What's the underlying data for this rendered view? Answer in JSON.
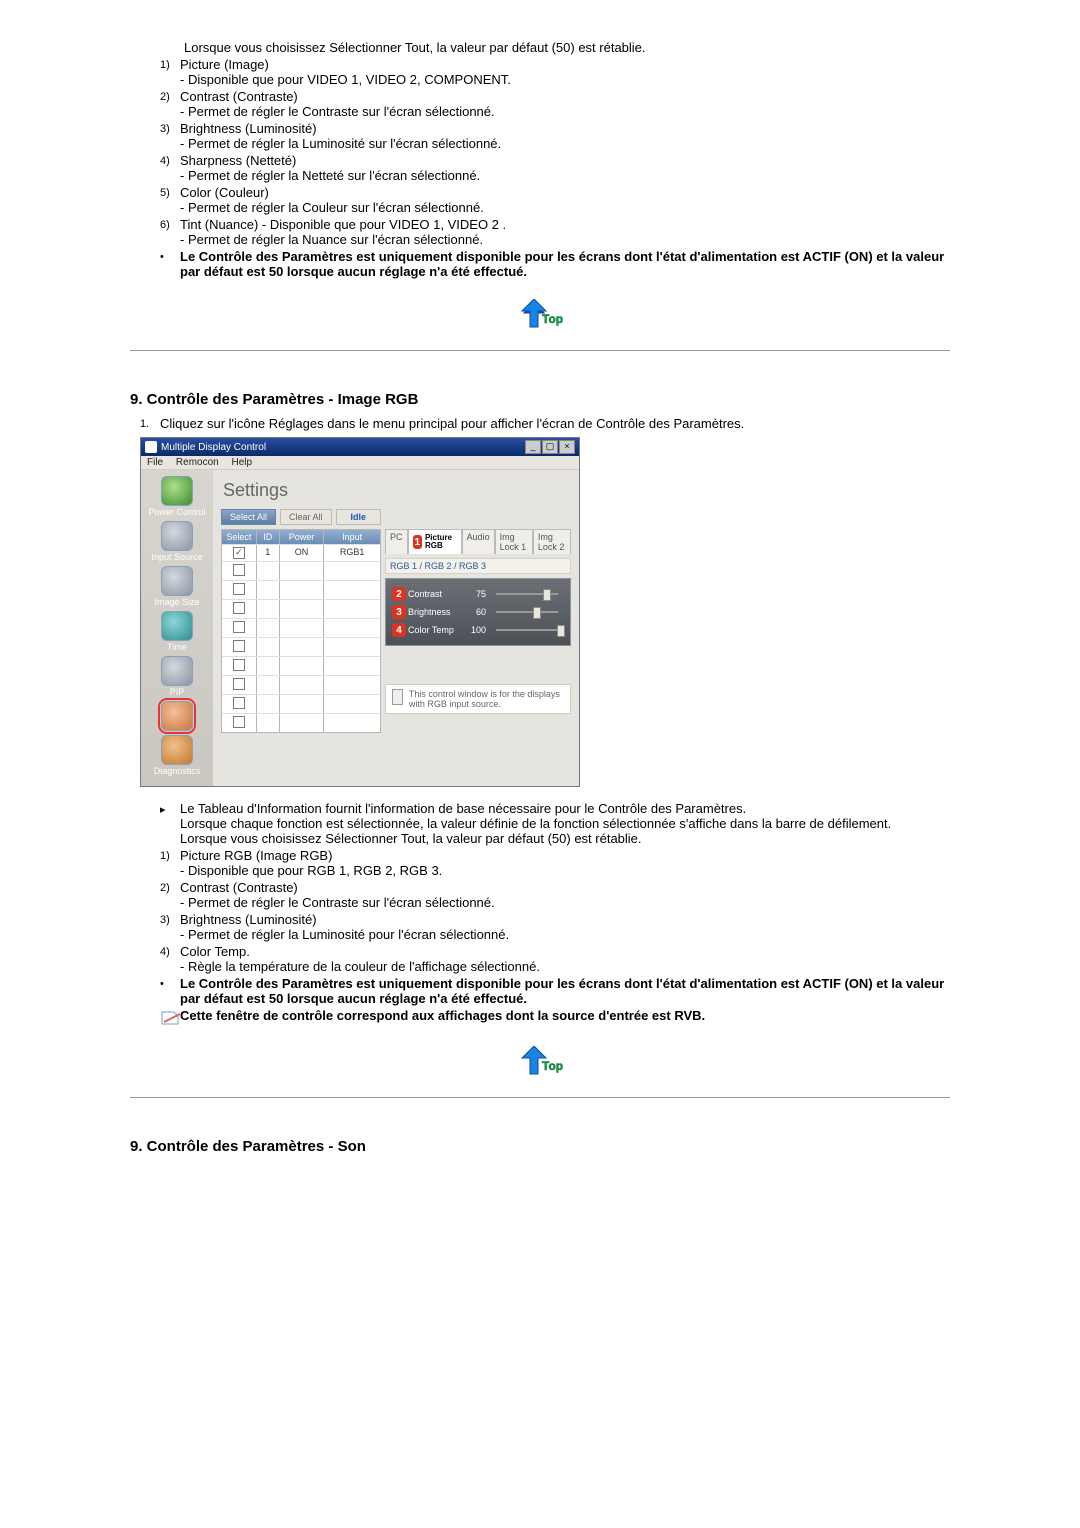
{
  "top_text": {
    "intro_default": "Lorsque vous choisissez Sélectionner Tout, la valeur par défaut (50) est rétablie.",
    "items": [
      {
        "num": "1)",
        "title": "Picture (Image)",
        "sub": "- Disponible que pour VIDEO 1, VIDEO 2, COMPONENT."
      },
      {
        "num": "2)",
        "title": "Contrast (Contraste)",
        "sub": "- Permet de régler le Contraste sur l'écran sélectionné."
      },
      {
        "num": "3)",
        "title": "Brightness (Luminosité)",
        "sub": "- Permet de régler la Luminosité sur l'écran sélectionné."
      },
      {
        "num": "4)",
        "title": "Sharpness (Netteté)",
        "sub": "- Permet de régler la Netteté sur l'écran sélectionné."
      },
      {
        "num": "5)",
        "title": "Color (Couleur)",
        "sub": "- Permet de régler la Couleur sur l'écran sélectionné."
      }
    ],
    "item6_num": "6)",
    "item6_a": "Tint (Nuance)",
    "item6_b": "- Disponible que pour VIDEO 1, VIDEO 2 .",
    "item6_sub": "- Permet de régler la Nuance sur l'écran sélectionné.",
    "note_bold": "Le Contrôle des Paramètres est uniquement disponible pour les écrans dont l'état d'alimentation est ACTIF (ON) et la valeur par défaut est 50 lorsque aucun réglage n'a été effectué."
  },
  "section_rgb": {
    "heading": "9. Contrôle des Paramètres - Image RGB",
    "step1_num": "1.",
    "step1": "Cliquez sur l'icône Réglages dans le menu principal pour afficher l'écran de Contrôle des Paramètres."
  },
  "mdc": {
    "title": "Multiple Display Control",
    "menus": [
      "File",
      "Remocon",
      "Help"
    ],
    "sidebar": [
      {
        "label": "Power Control",
        "cls": "green"
      },
      {
        "label": "Input Source",
        "cls": "grey"
      },
      {
        "label": "Image Size",
        "cls": "grey"
      },
      {
        "label": "Time",
        "cls": "teal"
      },
      {
        "label": "PIP",
        "cls": "grey"
      },
      {
        "label": "",
        "cls": "active"
      },
      {
        "label": "Diagnostics",
        "cls": "orange"
      }
    ],
    "main_title": "Settings",
    "toolbar": {
      "select_all": "Select All",
      "clear_all": "Clear All",
      "idle": "Idle"
    },
    "table": {
      "headers": [
        "Select",
        "ID",
        "Power",
        "Input"
      ],
      "row1": {
        "checked": true,
        "id": "1",
        "power": "ON",
        "input": "RGB1"
      }
    },
    "tabs": [
      "PC",
      "Picture RGB",
      "Audio",
      "Img Lock 1",
      "Img Lock 2"
    ],
    "active_tab": "Picture RGB",
    "subtabs": "RGB 1 / RGB 2 / RGB 3",
    "sliders": [
      {
        "num": "2",
        "label": "Contrast",
        "val": "75",
        "pos": 75
      },
      {
        "num": "3",
        "label": "Brightness",
        "val": "60",
        "pos": 60
      },
      {
        "num": "4",
        "label": "Color Temp",
        "val": "100",
        "pos": 100
      }
    ],
    "info": "This control window is for the displays with RGB input source."
  },
  "section_rgb_after": {
    "info_line1": "Le Tableau d'Information fournit l'information de base nécessaire pour le Contrôle des Paramètres.",
    "info_line2": "Lorsque chaque fonction est sélectionnée, la valeur définie de la fonction sélectionnée s'affiche dans la barre de défilement.",
    "info_line3": "Lorsque vous choisissez Sélectionner Tout, la valeur par défaut (50) est rétablie.",
    "items": [
      {
        "num": "1)",
        "title": "Picture RGB (Image RGB)",
        "sub": "- Disponible que pour RGB 1, RGB 2, RGB 3."
      },
      {
        "num": "2)",
        "title": "Contrast (Contraste)",
        "sub": "- Permet de régler le Contraste sur l'écran sélectionné."
      },
      {
        "num": "3)",
        "title": "Brightness (Luminosité)",
        "sub": "- Permet de régler la Luminosité pour l'écran sélectionné."
      },
      {
        "num": "4)",
        "title": "Color Temp.",
        "sub": "- Règle la température de la couleur de l'affichage sélectionné."
      }
    ],
    "note_bold": "Le Contrôle des Paramètres est uniquement disponible pour les écrans dont l'état d'alimentation est ACTIF (ON) et la valeur par défaut est 50 lorsque aucun réglage n'a été effectué.",
    "note2_bold": "Cette fenêtre de contrôle correspond aux affichages dont la source d'entrée est RVB."
  },
  "section_son": {
    "heading": "9. Contrôle des Paramètres - Son"
  },
  "labels": {
    "top": "Top"
  }
}
